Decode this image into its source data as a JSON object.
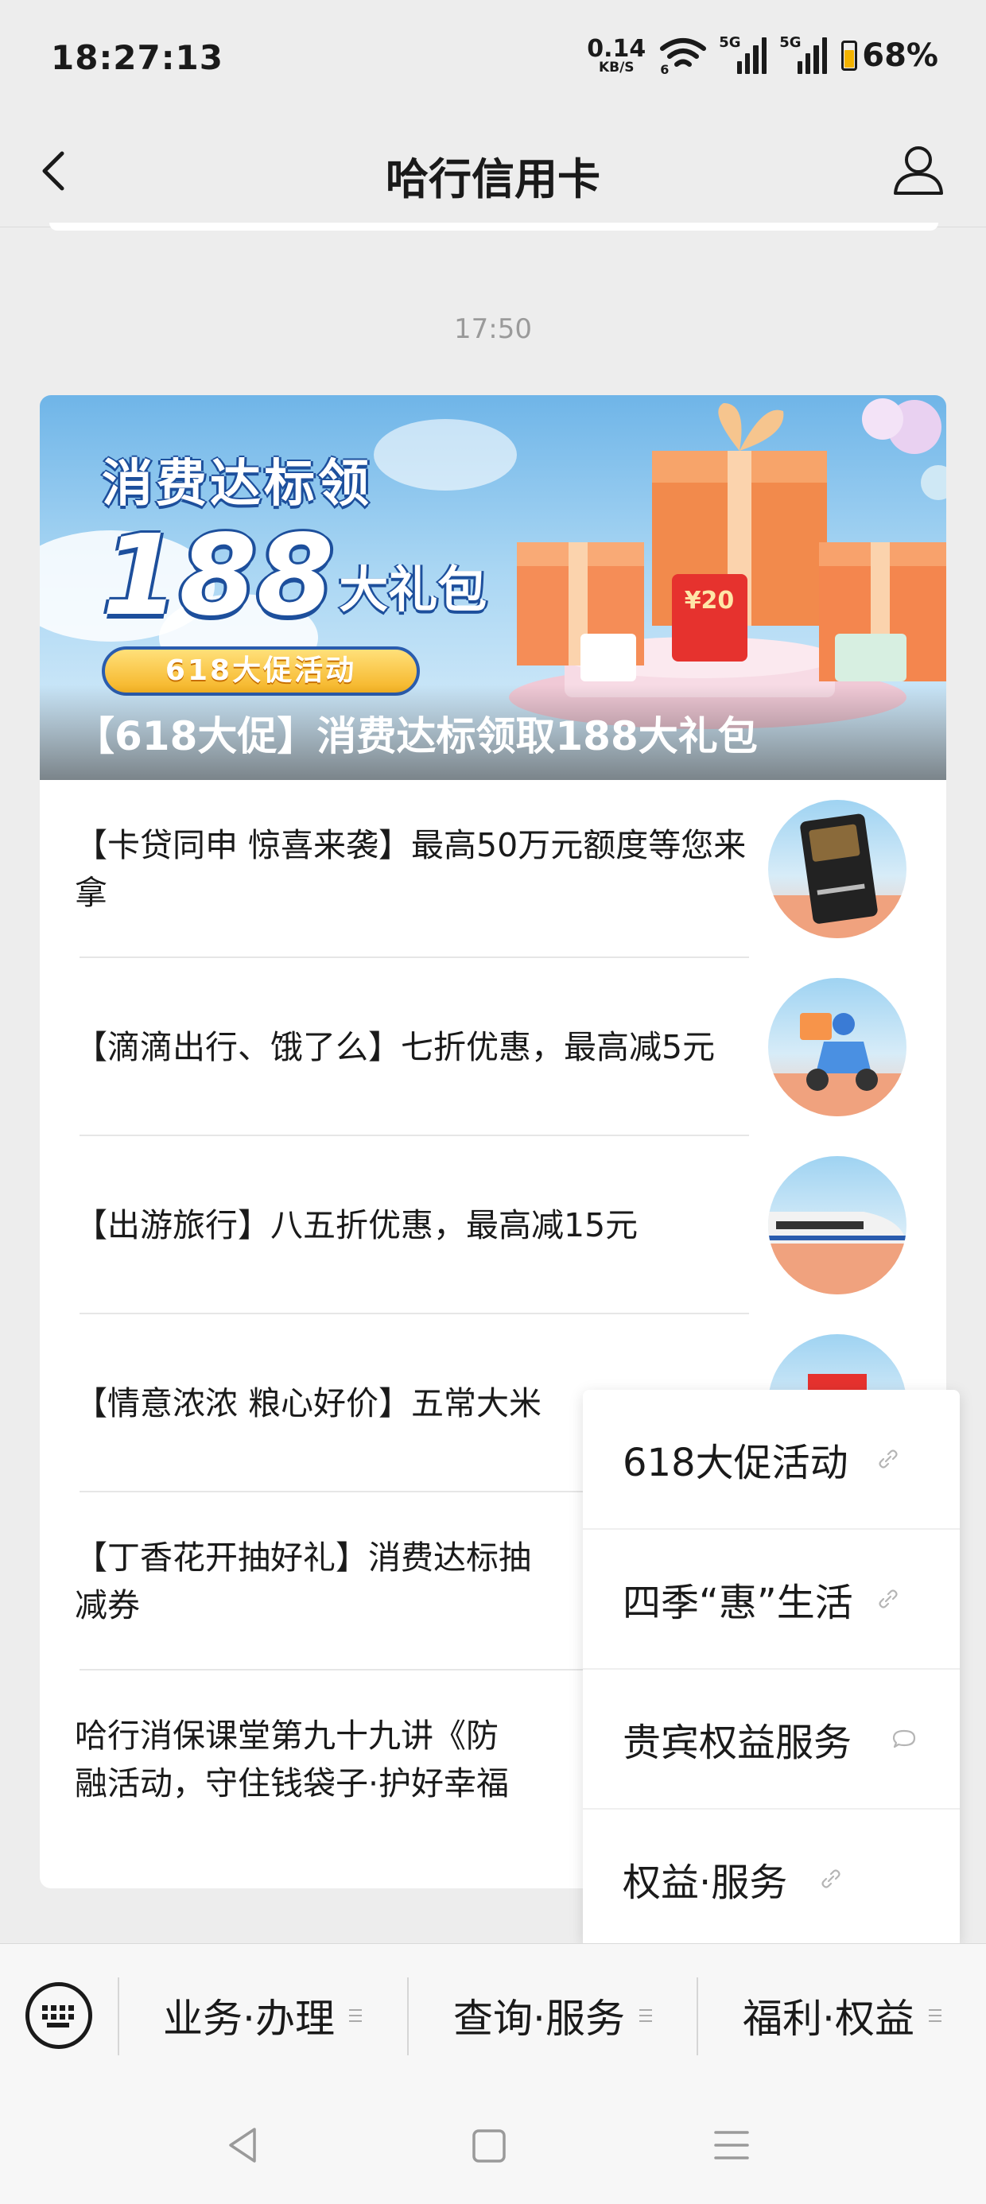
{
  "status_bar": {
    "time": "18:27:13",
    "net_speed_value": "0.14",
    "net_speed_unit": "KB/S",
    "wifi_tag": "6",
    "sim1_tag": "5G",
    "sim2_tag": "5G",
    "battery_percent": "68%",
    "battery_level": 0.68,
    "battery_color": "#f3b300"
  },
  "nav": {
    "title": "哈行信用卡",
    "back_icon": "chevron-left-icon",
    "profile_icon": "user-icon"
  },
  "message_time": "17:50",
  "article": {
    "banner": {
      "line1": "消费达标领",
      "number": "188",
      "gift_text": "大礼包",
      "pill_text": "618大促活动",
      "envelope_amount": "¥20",
      "caption": "【618大促】消费达标领取188大礼包"
    },
    "items": [
      {
        "title": "【卡贷同申 惊喜来袭】最高50万元额度等您来拿",
        "thumb": "credit-card-thumb"
      },
      {
        "title": "【滴滴出行、饿了么】七折优惠，最高减5元",
        "thumb": "scooter-delivery-thumb"
      },
      {
        "title": "【出游旅行】八五折优惠，最高减15元",
        "thumb": "bullet-train-thumb"
      },
      {
        "title": "【情意浓浓 粮心好价】五常大米",
        "thumb": "gift-thumb"
      },
      {
        "title": "【丁香花开抽好礼】消费达标抽",
        "title_line2": "减券",
        "thumb": ""
      },
      {
        "title": "哈行消保课堂第九十九讲《防",
        "title_line2": "融活动，守住钱袋子·护好幸福",
        "thumb": ""
      }
    ]
  },
  "popup_menu": [
    {
      "label": "618大促活动",
      "icon": "link-icon"
    },
    {
      "label": "四季“惠”生活",
      "icon": "link-icon"
    },
    {
      "label": "贵宾权益服务",
      "icon": "chat-bubble-icon"
    },
    {
      "label": "权益·服务",
      "icon": "link-icon"
    }
  ],
  "bottom_menu": [
    {
      "label": "业务·办理"
    },
    {
      "label": "查询·服务"
    },
    {
      "label": "福利·权益"
    }
  ],
  "system_nav": [
    "back-triangle-icon",
    "home-square-icon",
    "menu-lines-icon"
  ]
}
